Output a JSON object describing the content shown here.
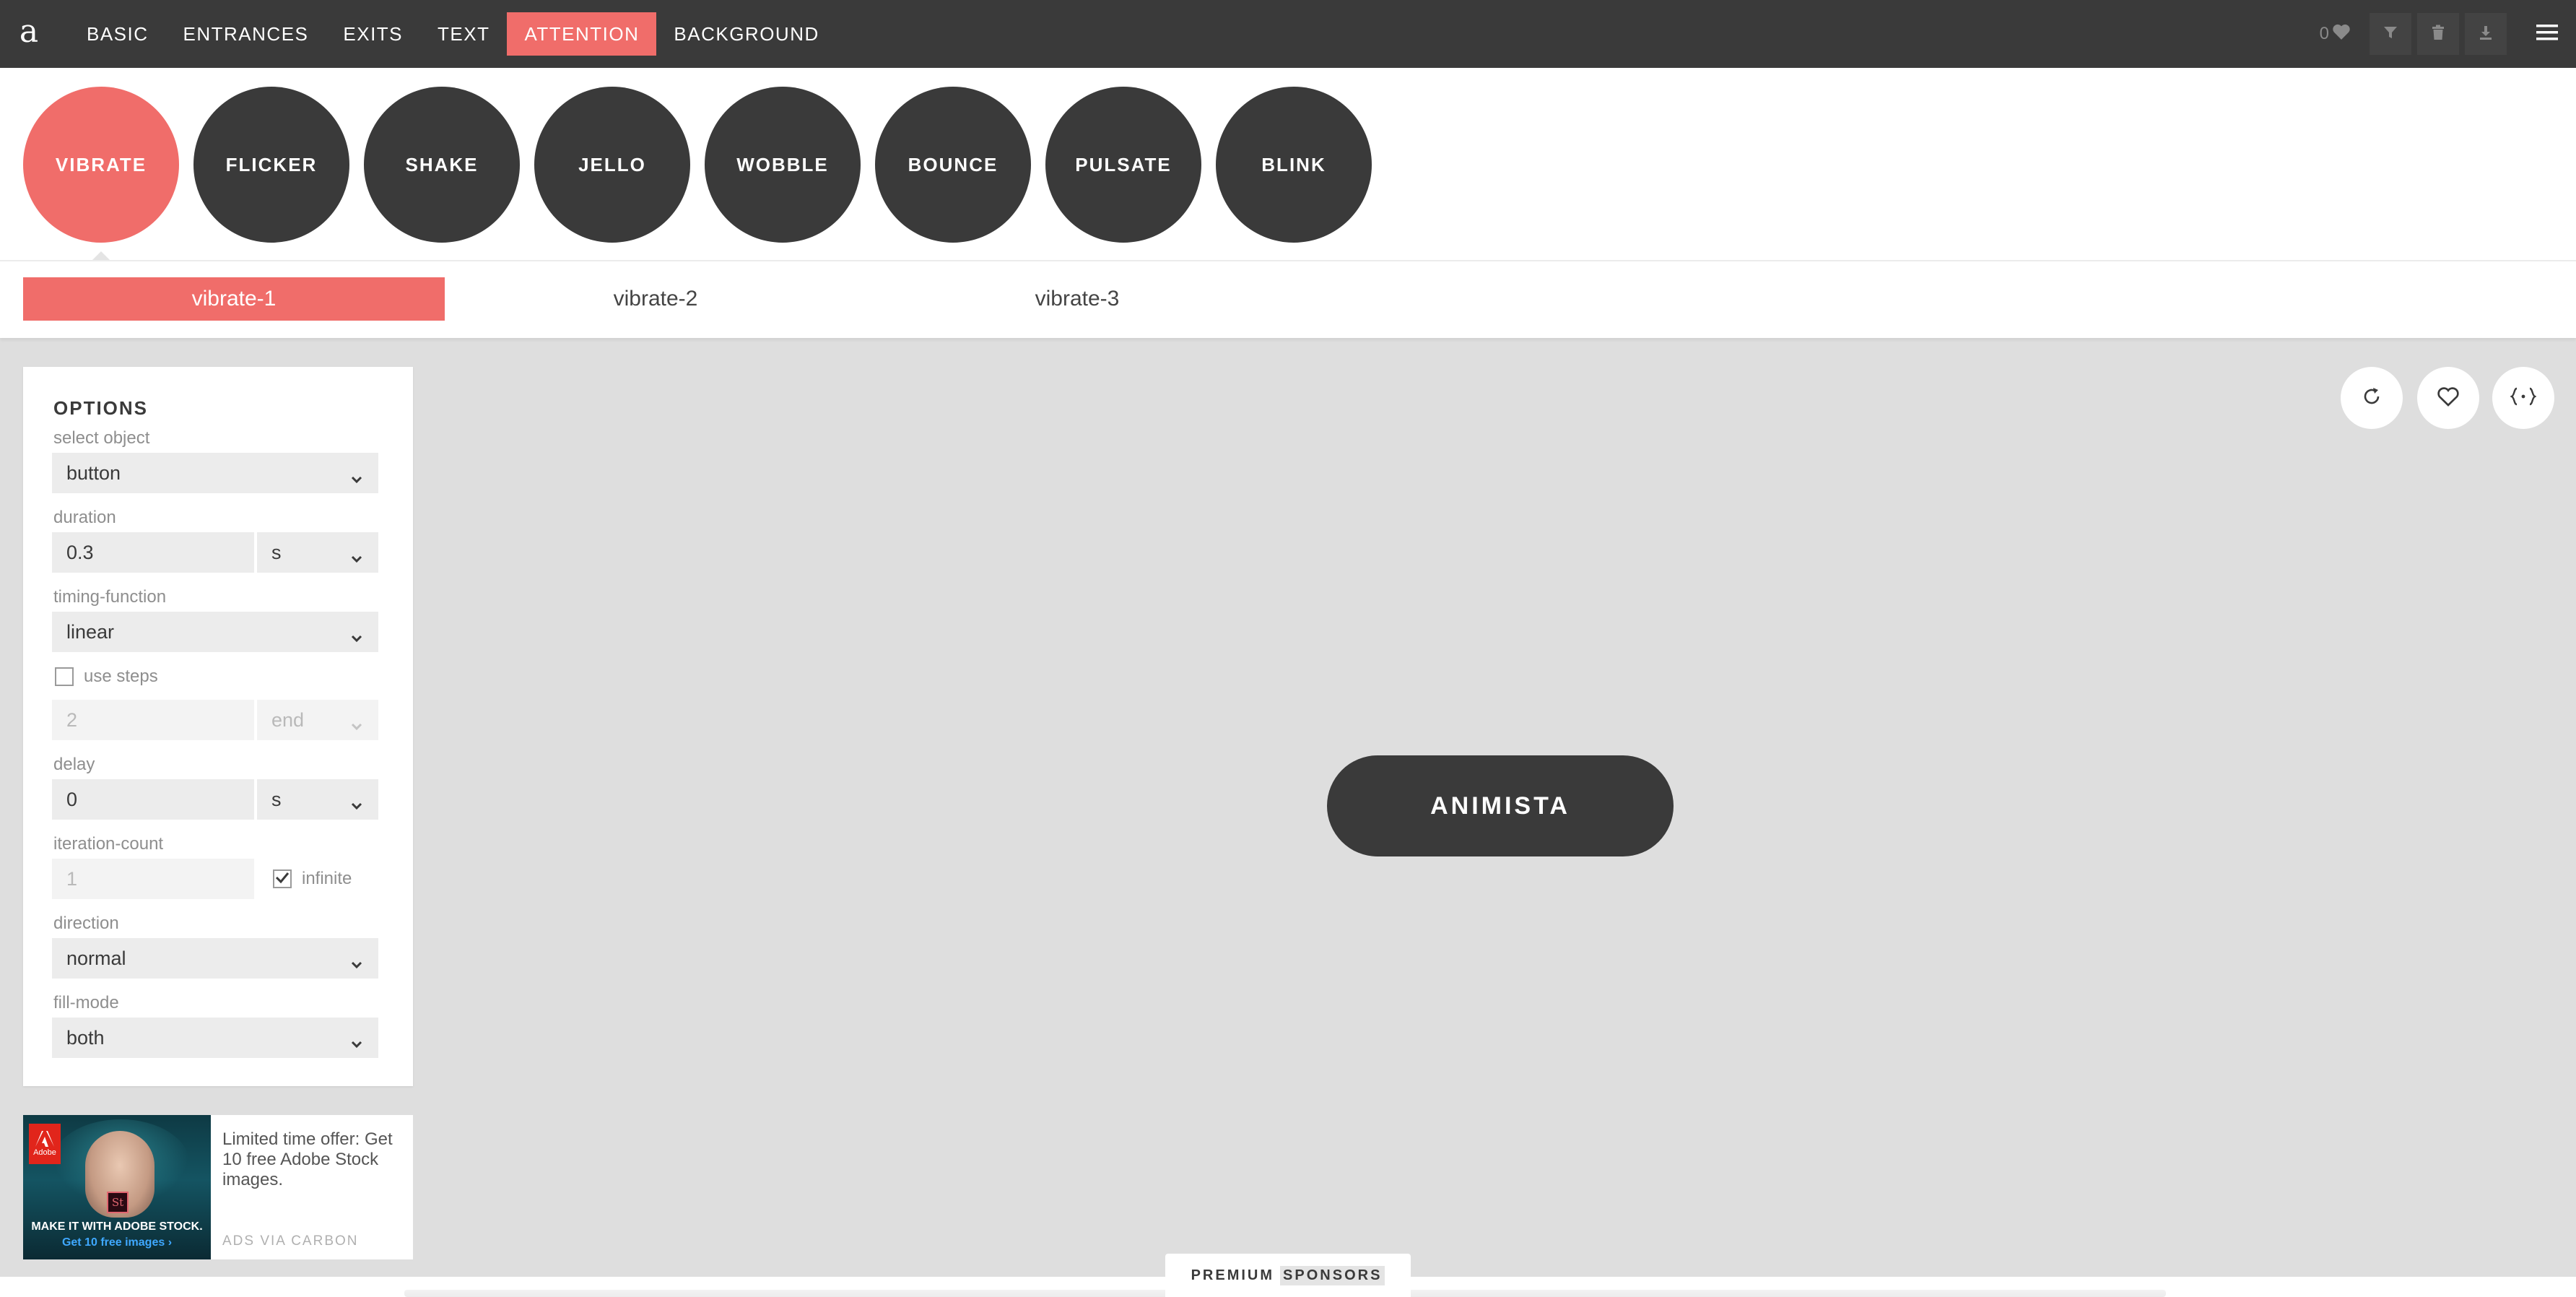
{
  "logo": "a",
  "nav": [
    "BASIC",
    "ENTRANCES",
    "EXITS",
    "TEXT",
    "ATTENTION",
    "BACKGROUND"
  ],
  "nav_active": "ATTENTION",
  "favorites_count": "0",
  "animations": [
    "VIBRATE",
    "FLICKER",
    "SHAKE",
    "JELLO",
    "WOBBLE",
    "BOUNCE",
    "PULSATE",
    "BLINK"
  ],
  "variants": [
    "vibrate-1",
    "vibrate-2",
    "vibrate-3"
  ],
  "options": {
    "title": "OPTIONS",
    "select_object": {
      "label": "select object",
      "value": "button"
    },
    "duration": {
      "label": "duration",
      "value": "0.3",
      "unit": "s"
    },
    "timing_function": {
      "label": "timing-function",
      "value": "linear"
    },
    "use_steps": {
      "label": "use steps",
      "checked": false,
      "value": "2",
      "position": "end"
    },
    "delay": {
      "label": "delay",
      "value": "0",
      "unit": "s"
    },
    "iteration_count": {
      "label": "iteration-count",
      "value": "1",
      "infinite_label": "infinite",
      "infinite": true
    },
    "direction": {
      "label": "direction",
      "value": "normal"
    },
    "fill_mode": {
      "label": "fill-mode",
      "value": "both"
    }
  },
  "ad": {
    "brand": "Adobe",
    "badge": "St",
    "image_line1": "MAKE IT WITH ADOBE STOCK.",
    "image_line2": "Get 10 free images ›",
    "copy": "Limited time offer: Get 10 free Adobe Stock images.",
    "via": "ADS VIA CARBON"
  },
  "demo_button": "ANIMISTA",
  "footer": {
    "premium": "PREMIUM",
    "sponsors": "SPONSORS"
  },
  "colors": {
    "accent": "#f06d6a",
    "dark": "#3a3a3a",
    "stage": "#dedede"
  }
}
